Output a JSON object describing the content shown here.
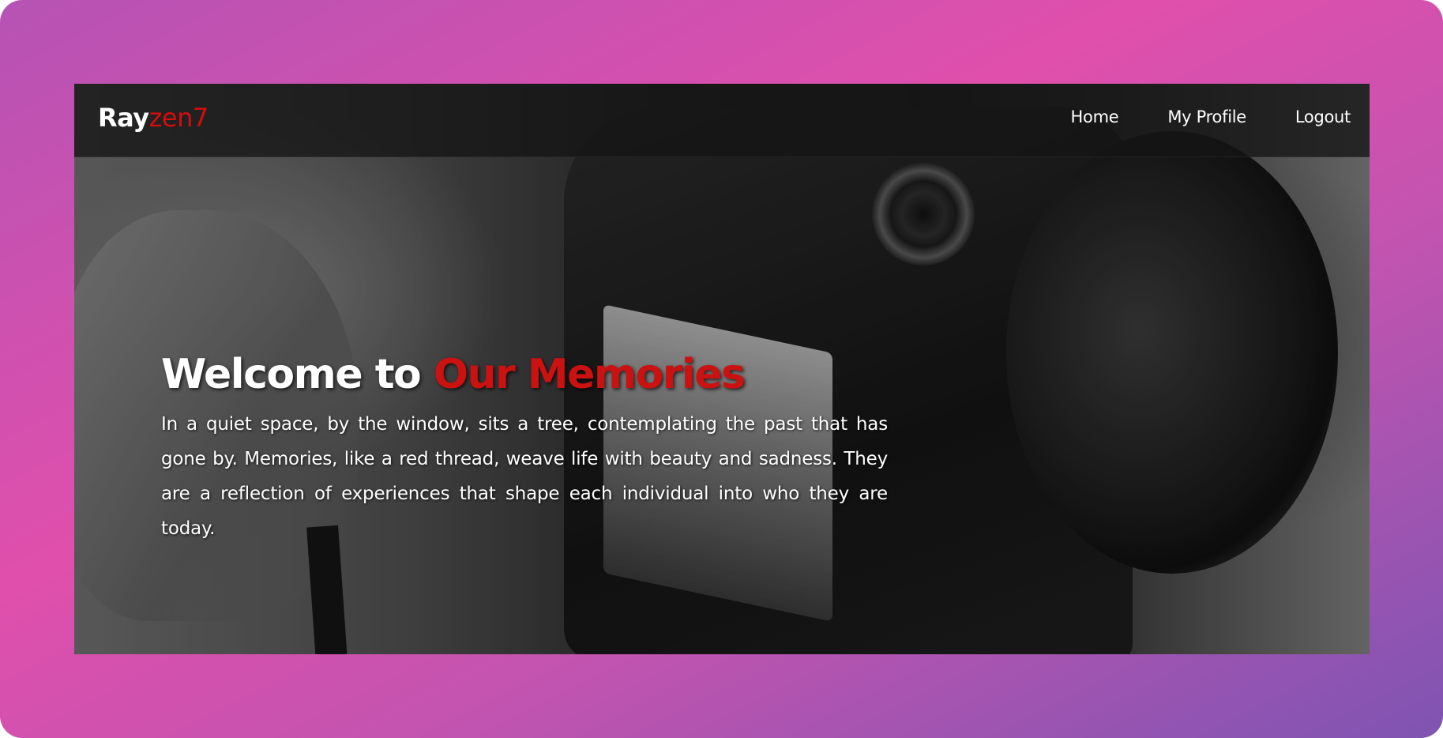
{
  "brand": {
    "part1": "Ray",
    "part2": "zen7"
  },
  "nav": {
    "items": [
      {
        "label": "Home"
      },
      {
        "label": "My Profile"
      },
      {
        "label": "Logout"
      }
    ]
  },
  "hero": {
    "title_prefix": "Welcome to ",
    "title_accent": "Our Memories",
    "description": "In a quiet space, by the window, sits a tree, contemplating the past that has gone by. Memories, like a red thread, weave life with beauty and sadness. They are a reflection of experiences that shape each individual into who they are today."
  },
  "colors": {
    "accent": "#cc1111",
    "frame_gradient_start": "#b653b4",
    "frame_gradient_mid": "#e04fac",
    "frame_gradient_end": "#7f54b2",
    "navbar": "#141414"
  }
}
